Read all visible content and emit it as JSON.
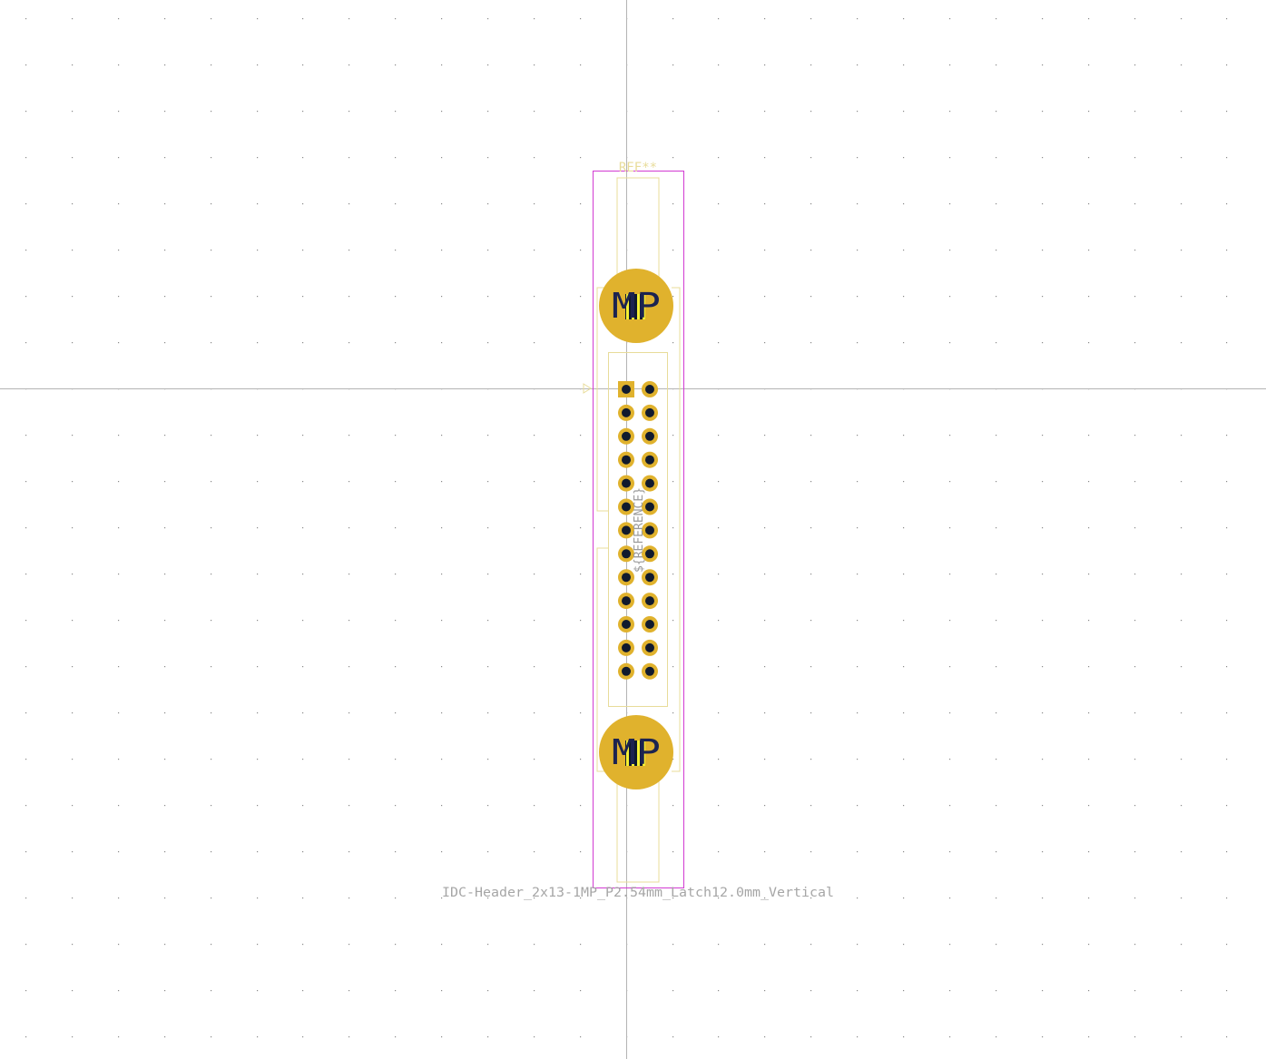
{
  "footprint": {
    "reference_label": "REF**",
    "value_label": "IDC-Header_2x13-1MP_P2.54mm_Latch12.0mm_Vertical",
    "fab_reference_label": "${REFERENCE}",
    "mounting_pad_label": "MP",
    "pin_rows": 13,
    "pin_columns": 2
  },
  "colors": {
    "background": "#ffffff",
    "grid": "#8a8a8a",
    "crosshair": "#b4b4b4",
    "courtyard": "#d23ad2",
    "silkscreen": "#e8dc9a",
    "fab": "#c9c074",
    "pad": "#e0b22d",
    "hole": "#101a2e",
    "fab_text": "#9a9a9a",
    "value_text": "#a6a6a6",
    "mp_text": "#1c2350",
    "mp_stripe": "#f5f032"
  }
}
